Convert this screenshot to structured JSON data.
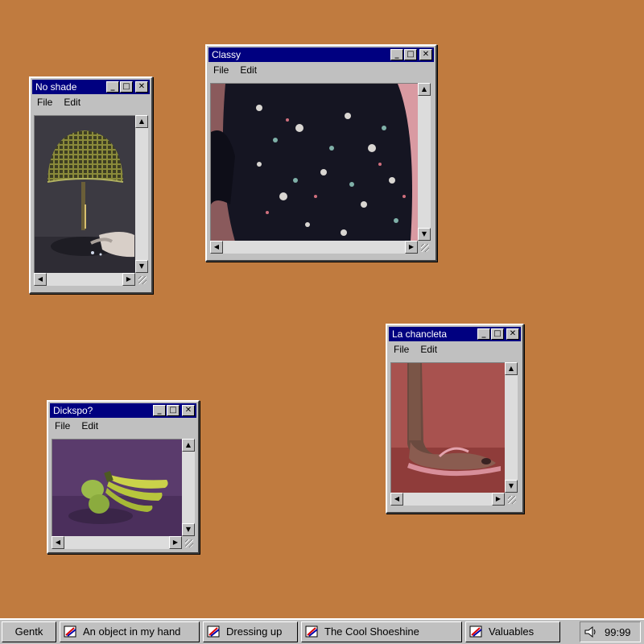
{
  "desktop": {
    "background": "#c07b3f"
  },
  "windows": {
    "no_shade": {
      "title": "No shade",
      "menu": [
        "File",
        "Edit"
      ],
      "image_icon": "lamp-photo"
    },
    "classy": {
      "title": "Classy",
      "menu": [
        "File",
        "Edit"
      ],
      "image_icon": "floral-jacket-photo"
    },
    "la_chancleta": {
      "title": "La chancleta",
      "menu": [
        "File",
        "Edit"
      ],
      "image_icon": "flip-flop-photo"
    },
    "dickspo": {
      "title": "Dickspo?",
      "menu": [
        "File",
        "Edit"
      ],
      "image_icon": "bananas-pears-photo"
    }
  },
  "window_buttons": {
    "minimize": "_",
    "maximize": "□",
    "close": "✕"
  },
  "scroll": {
    "up": "▲",
    "down": "▼",
    "left": "◀",
    "right": "▶"
  },
  "taskbar": {
    "start_label": "Gentk",
    "tasks": [
      "An object in my hand",
      "Dressing up",
      "The Cool Shoeshine",
      "Valuables"
    ],
    "clock": "99:99",
    "tray_icon": "speaker-icon"
  }
}
